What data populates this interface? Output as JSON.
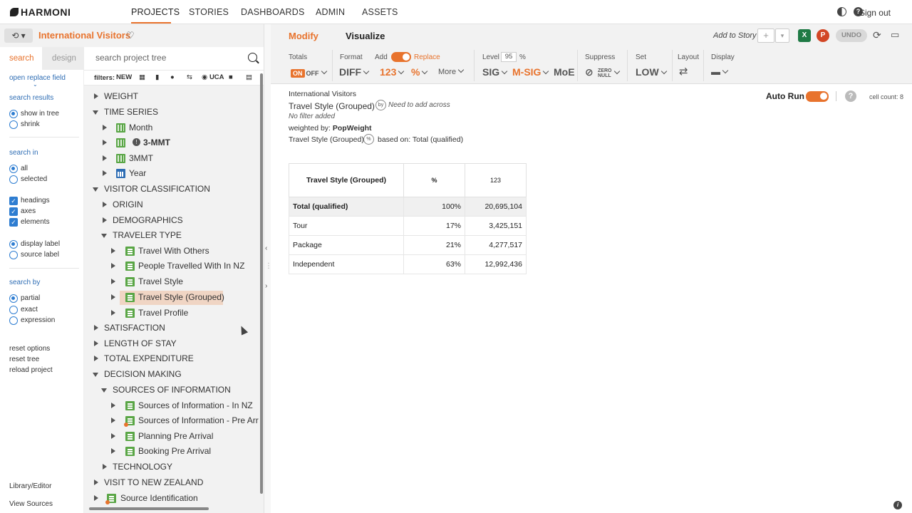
{
  "app": {
    "logo_text": "HARMONI",
    "nav": [
      "PROJECTS",
      "STORIES",
      "DASHBOARDS",
      "ADMIN",
      "ASSETS"
    ],
    "sign_out": "Sign out"
  },
  "project": {
    "title": "International Visitors",
    "history_label": "⟲ ▾"
  },
  "options_panel": {
    "tab_search": "search",
    "tab_design": "design",
    "open_replace_field": "open replace field",
    "search_results": "search results",
    "show_in_tree": "show in tree",
    "shrink": "shrink",
    "search_in": "search in",
    "all": "all",
    "selected": "selected",
    "headings": "headings",
    "axes": "axes",
    "elements": "elements",
    "display_label": "display label",
    "source_label": "source label",
    "search_by": "search by",
    "partial": "partial",
    "exact": "exact",
    "expression": "expression",
    "reset_options": "reset options",
    "reset_tree": "reset tree",
    "reload_project": "reload project",
    "library_editor": "Library/Editor",
    "view_sources": "View Sources"
  },
  "tree": {
    "search_placeholder": "search project tree",
    "filters_label": "filters:",
    "filter_new": "NEW",
    "filter_uca": "UCA",
    "nodes": {
      "weight": "WEIGHT",
      "time_series": "TIME SERIES",
      "month": "Month",
      "three_mmt_bold": "3-MMT",
      "three_mmt": "3MMT",
      "year": "Year",
      "visitor_classification": "VISITOR CLASSIFICATION",
      "origin": "ORIGIN",
      "demographics": "DEMOGRAPHICS",
      "traveler_type": "TRAVELER TYPE",
      "travel_with_others": "Travel With Others",
      "people_travelled": "People Travelled With In NZ",
      "travel_style": "Travel Style",
      "travel_style_grouped": "Travel Style (Grouped)",
      "travel_profile": "Travel Profile",
      "satisfaction": "SATISFACTION",
      "length_of_stay": "LENGTH OF STAY",
      "total_expenditure": "TOTAL EXPENDITURE",
      "decision_making": "DECISION MAKING",
      "sources_of_information": "SOURCES OF INFORMATION",
      "sources_in_nz": "Sources of Information - In NZ",
      "sources_pre_arr": "Sources of Information - Pre Arr",
      "planning_pre_arrival": "Planning Pre Arrival",
      "booking_pre_arrival": "Booking Pre Arrival",
      "technology": "TECHNOLOGY",
      "visit_to_nz": "VISIT TO NEW ZEALAND",
      "source_identification": "Source Identification"
    }
  },
  "right_header": {
    "tab_modify": "Modify",
    "tab_visualize": "Visualize",
    "add_to_story": "Add to Story",
    "undo": "UNDO",
    "excel": "X",
    "ppt": "P"
  },
  "toolbar": {
    "totals": "Totals",
    "on": "ON",
    "off": "OFF",
    "format": "Format",
    "diff": "DIFF",
    "add": "Add",
    "replace": "Replace",
    "n123": "123",
    "pct": "%",
    "more": "More",
    "level": "Level",
    "level_value": "95",
    "level_pct": "%",
    "sig": "SIG",
    "msig": "M-SIG",
    "moe": "MoE",
    "suppress": "Suppress",
    "zero_null": "ZERO NULL",
    "set": "Set",
    "low": "LOW",
    "layout": "Layout",
    "display": "Display"
  },
  "content": {
    "project_name": "International Visitors",
    "table_title": "Travel Style (Grouped)",
    "by_badge": "by",
    "need_to_add": "Need to add across",
    "no_filter": "No filter added",
    "weighted_by_label": "weighted by:",
    "weighted_by_value": "PopWeight",
    "based_on_field": "Travel Style (Grouped)",
    "pct_badge": "%",
    "based_on_label": "based on:",
    "based_on_value": "Total (qualified)",
    "auto_run": "Auto Run",
    "cell_count": "cell count: 8",
    "help": "?",
    "info": "i"
  },
  "table": {
    "headers": [
      "Travel Style (Grouped)",
      "%",
      "123"
    ],
    "rows": [
      [
        "Total (qualified)",
        "100%",
        "20,695,104"
      ],
      [
        "Tour",
        "17%",
        "3,425,151"
      ],
      [
        "Package",
        "21%",
        "4,277,517"
      ],
      [
        "Independent",
        "63%",
        "12,992,436"
      ]
    ]
  },
  "colors": {
    "accent": "#e8732d",
    "link": "#2e6db4",
    "green_icon": "#5aa646",
    "selected_row": "#f0d5c4"
  }
}
